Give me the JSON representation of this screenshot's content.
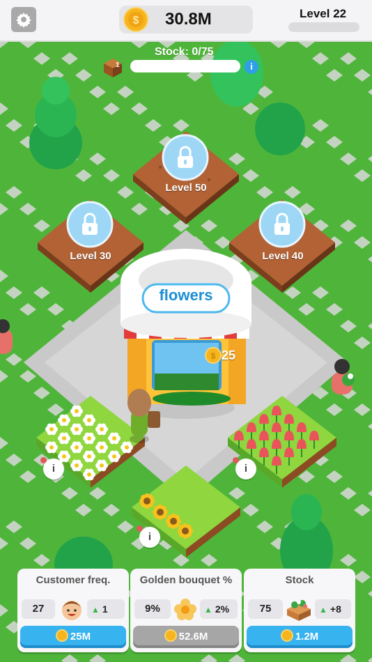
{
  "top_bar": {
    "money": "30.8M",
    "level": "Level 22",
    "settings_icon": "gear-icon"
  },
  "stock": {
    "label": "Stock: 0/75",
    "crate_count": "1",
    "info": "i"
  },
  "plots": {
    "locked": [
      {
        "label": "Level 50"
      },
      {
        "label": "Level 30"
      },
      {
        "label": "Level 40"
      }
    ]
  },
  "shop": {
    "sign": "flowers",
    "income": "25"
  },
  "field_info": [
    "i",
    "i",
    "i"
  ],
  "cards": {
    "customer": {
      "title": "Customer freq.",
      "value": "27",
      "upgrade": "1",
      "price": "25M",
      "button_state": "available"
    },
    "golden": {
      "title": "Golden bouquet %",
      "value": "9%",
      "upgrade": "2%",
      "price": "52.6M",
      "button_state": "unavailable"
    },
    "stock": {
      "title": "Stock",
      "value": "75",
      "upgrade": "+8",
      "price": "1.2M",
      "button_state": "available"
    }
  },
  "colors": {
    "grass": "#4fb53a",
    "soil": "#a0522d",
    "accent_blue": "#37b3f0",
    "coin": "#f7b51d"
  }
}
